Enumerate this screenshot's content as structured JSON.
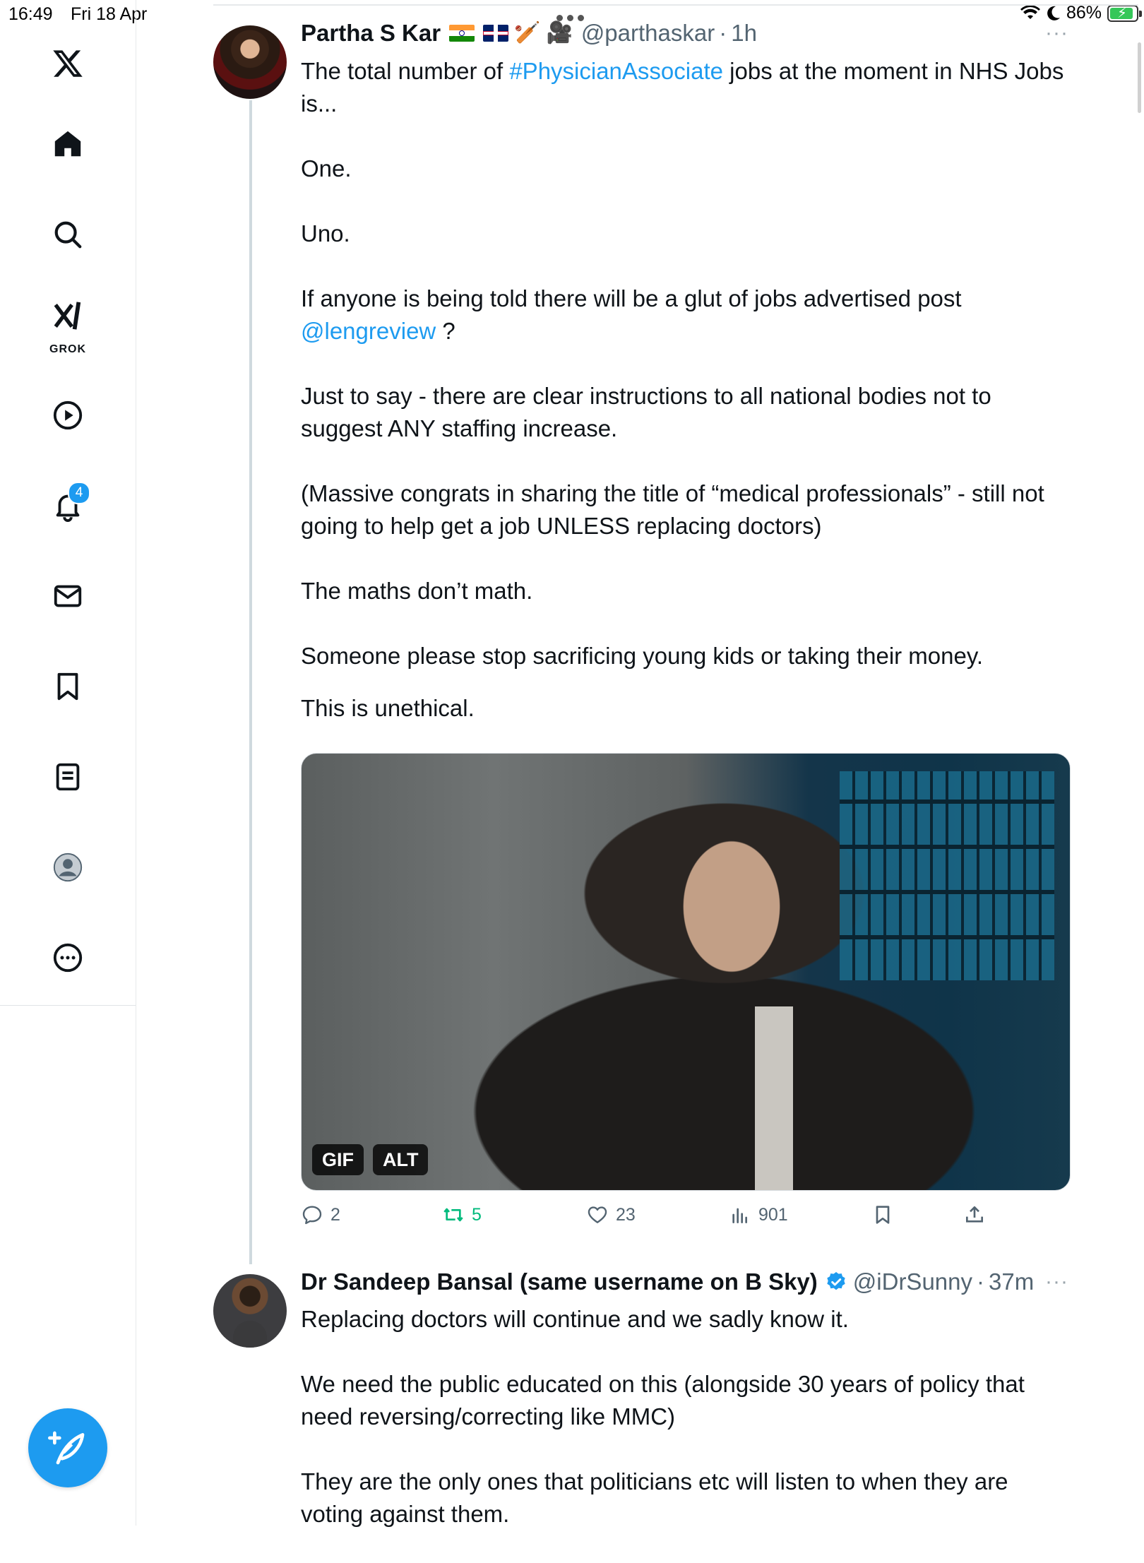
{
  "status_bar": {
    "time": "16:49",
    "date": "Fri 18 Apr",
    "battery_percent": "86%"
  },
  "nav": {
    "items": [
      {
        "name": "x-logo",
        "label": ""
      },
      {
        "name": "home",
        "label": ""
      },
      {
        "name": "explore",
        "label": ""
      },
      {
        "name": "grok",
        "label": "GROK"
      },
      {
        "name": "video",
        "label": ""
      },
      {
        "name": "notifications",
        "label": ""
      },
      {
        "name": "messages",
        "label": ""
      },
      {
        "name": "bookmarks",
        "label": ""
      },
      {
        "name": "lists",
        "label": ""
      },
      {
        "name": "profile",
        "label": ""
      },
      {
        "name": "more",
        "label": ""
      }
    ],
    "notifications_count": "4",
    "grok_label": "GROK"
  },
  "colors": {
    "accent": "#1d9bf0",
    "retweet_active": "#00ba7c",
    "text": "#0f1419",
    "muted": "#536471"
  },
  "post1": {
    "author_name": "Partha S Kar",
    "handle": "@parthaskar",
    "separator": "·",
    "time": "1h",
    "more": "···",
    "line1_prefix": "The total number of ",
    "hashtag": "#PhysicianAssociate",
    "line1_suffix": " jobs at the moment in NHS Jobs is...",
    "para2": "One.",
    "para3": "Uno.",
    "para4_prefix": "If anyone is being told there will be a glut of jobs advertised post ",
    "mention": "@lengreview",
    "para4_suffix": " ?",
    "para5": "Just to say - there are clear instructions to all national bodies not to suggest ANY staffing increase.",
    "para6": "(Massive congrats in sharing the title of “medical professionals” - still not going to help get a job UNLESS replacing doctors)",
    "para7": "The maths don’t math.",
    "para8": "Someone please stop sacrificing young kids or taking their money.",
    "para9": "This is unethical.",
    "media_badges": {
      "gif": "GIF",
      "alt": "ALT"
    },
    "replies": "2",
    "reposts": "5",
    "likes": "23",
    "views": "901"
  },
  "post2": {
    "author_name": "Dr Sandeep Bansal (same username on B Sky)",
    "handle": "@iDrSunny",
    "separator": "·",
    "time": "37m",
    "more": "···",
    "para1": "Replacing doctors will continue and we sadly know it.",
    "para2": "We need the public educated on this (alongside 30 years of policy that need reversing/correcting like MMC)",
    "para3": "They are the only ones that politicians etc will listen to when they are voting against them."
  }
}
